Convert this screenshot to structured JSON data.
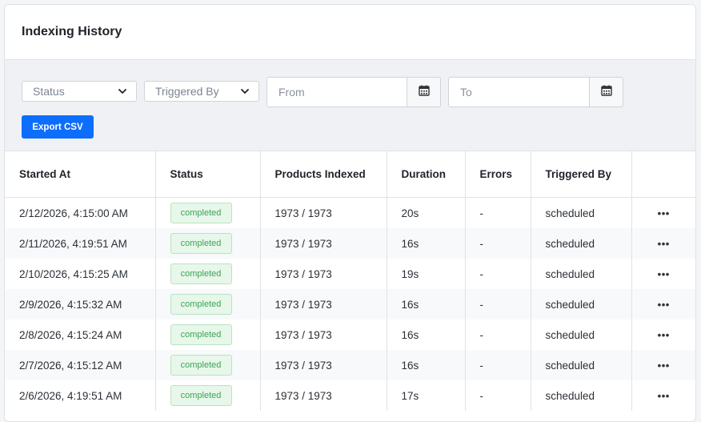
{
  "page": {
    "title": "Indexing History"
  },
  "filters": {
    "status_placeholder": "Status",
    "triggered_by_placeholder": "Triggered By",
    "from_placeholder": "From",
    "to_placeholder": "To",
    "export_label": "Export CSV"
  },
  "table": {
    "headers": [
      "Started At",
      "Status",
      "Products Indexed",
      "Duration",
      "Errors",
      "Triggered By"
    ],
    "rows": [
      {
        "started_at": "2/12/2026, 4:15:00 AM",
        "status": "completed",
        "products": "1973 / 1973",
        "duration": "20s",
        "errors": "-",
        "triggered_by": "scheduled",
        "actions": "•••"
      },
      {
        "started_at": "2/11/2026, 4:19:51 AM",
        "status": "completed",
        "products": "1973 / 1973",
        "duration": "16s",
        "errors": "-",
        "triggered_by": "scheduled",
        "actions": "•••"
      },
      {
        "started_at": "2/10/2026, 4:15:25 AM",
        "status": "completed",
        "products": "1973 / 1973",
        "duration": "19s",
        "errors": "-",
        "triggered_by": "scheduled",
        "actions": "•••"
      },
      {
        "started_at": "2/9/2026, 4:15:32 AM",
        "status": "completed",
        "products": "1973 / 1973",
        "duration": "16s",
        "errors": "-",
        "triggered_by": "scheduled",
        "actions": "•••"
      },
      {
        "started_at": "2/8/2026, 4:15:24 AM",
        "status": "completed",
        "products": "1973 / 1973",
        "duration": "16s",
        "errors": "-",
        "triggered_by": "scheduled",
        "actions": "•••"
      },
      {
        "started_at": "2/7/2026, 4:15:12 AM",
        "status": "completed",
        "products": "1973 / 1973",
        "duration": "16s",
        "errors": "-",
        "triggered_by": "scheduled",
        "actions": "•••"
      },
      {
        "started_at": "2/6/2026, 4:19:51 AM",
        "status": "completed",
        "products": "1973 / 1973",
        "duration": "17s",
        "errors": "-",
        "triggered_by": "scheduled",
        "actions": "•••"
      }
    ]
  },
  "icons": {
    "select_chevron": "chevron-down-icon",
    "date_picker": "calendar-icon",
    "row_actions": "more-horizontal-icon"
  },
  "colors": {
    "primary": "#0d6efd",
    "badge_text": "#3fa35a",
    "badge_bg": "#e7f7ea",
    "filter_bg": "#eff1f4"
  }
}
